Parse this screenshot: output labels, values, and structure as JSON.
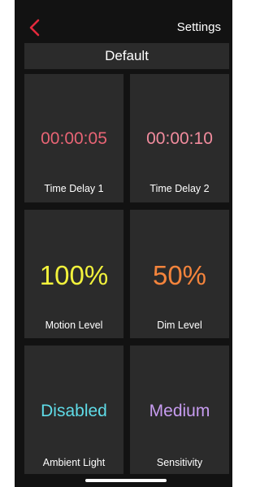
{
  "header": {
    "back_icon": "chevron-left-icon",
    "back_color": "#e3293c",
    "settings_label": "Settings"
  },
  "profile": {
    "name": "Default"
  },
  "tiles": [
    {
      "value": "00:00:05",
      "label": "Time Delay 1",
      "color": "#e86475"
    },
    {
      "value": "00:00:10",
      "label": "Time Delay 2",
      "color": "#f28c9e"
    },
    {
      "value": "100%",
      "label": "Motion Level",
      "color": "#f2f23c"
    },
    {
      "value": "50%",
      "label": "Dim Level",
      "color": "#f4843c"
    },
    {
      "value": "Disabled",
      "label": "Ambient Light",
      "color": "#5fdce8"
    },
    {
      "value": "Medium",
      "label": "Sensitivity",
      "color": "#c79cf0"
    }
  ]
}
